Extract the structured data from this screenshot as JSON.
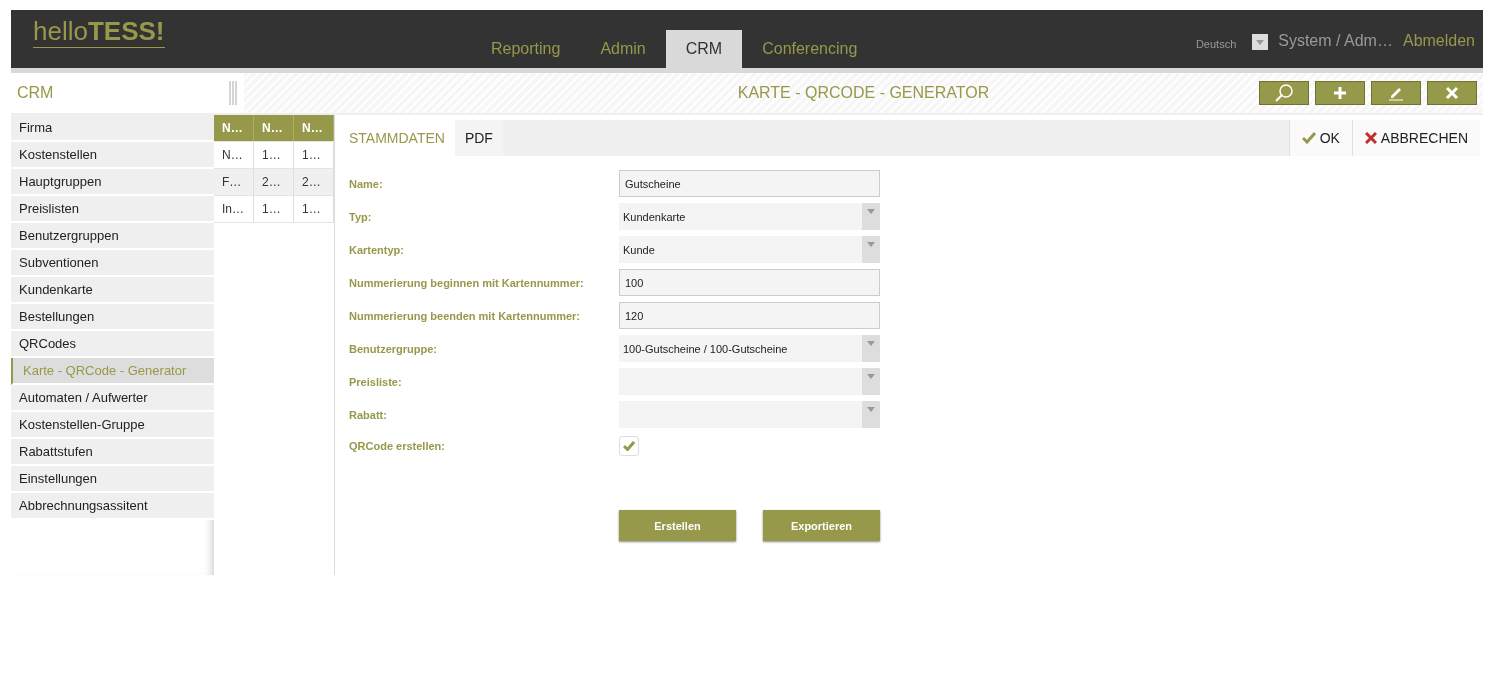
{
  "logo": {
    "light": "hello",
    "bold": "TESS!"
  },
  "nav": [
    {
      "label": "Reporting",
      "selected": false
    },
    {
      "label": "Admin",
      "selected": false
    },
    {
      "label": "CRM",
      "selected": true
    },
    {
      "label": "Conferencing",
      "selected": false
    }
  ],
  "language": "Deutsch",
  "user": "System / Adm…",
  "logout": "Abmelden",
  "module_title": "CRM",
  "page_title": "KARTE - QRCODE - GENERATOR",
  "sidebar": {
    "items": [
      {
        "label": "Firma",
        "selected": false
      },
      {
        "label": "Kostenstellen",
        "selected": false
      },
      {
        "label": "Hauptgruppen",
        "selected": false
      },
      {
        "label": "Preislisten",
        "selected": false
      },
      {
        "label": "Benutzergruppen",
        "selected": false
      },
      {
        "label": "Subventionen",
        "selected": false
      },
      {
        "label": "Kundenkarte",
        "selected": false
      },
      {
        "label": "Bestellungen",
        "selected": false
      },
      {
        "label": "QRCodes",
        "selected": false
      },
      {
        "label": "Karte - QRCode - Generator",
        "selected": true
      },
      {
        "label": "Automaten / Aufwerter",
        "selected": false
      },
      {
        "label": "Kostenstellen-Gruppe",
        "selected": false
      },
      {
        "label": "Rabattstufen",
        "selected": false
      },
      {
        "label": "Einstellungen",
        "selected": false
      },
      {
        "label": "Abbrechnungsassitent",
        "selected": false
      }
    ]
  },
  "table": {
    "columns": [
      "N…",
      "N…",
      "N…"
    ],
    "rows": [
      [
        "N…",
        "1…",
        "1…"
      ],
      [
        "F…",
        "2…",
        "2…"
      ],
      [
        "In…",
        "1…",
        "1…"
      ]
    ]
  },
  "tabs": [
    {
      "label": "STAMMDATEN",
      "selected": true
    },
    {
      "label": "PDF",
      "selected": false
    }
  ],
  "actions": {
    "ok": "OK",
    "cancel": "ABBRECHEN"
  },
  "form": [
    {
      "kind": "text",
      "label": "Name:",
      "value": "Gutscheine"
    },
    {
      "kind": "select",
      "label": "Typ:",
      "value": "Kundenkarte"
    },
    {
      "kind": "select",
      "label": "Kartentyp:",
      "value": "Kunde"
    },
    {
      "kind": "text",
      "label": "Nummerierung beginnen mit Kartennummer:",
      "value": "100"
    },
    {
      "kind": "text",
      "label": "Nummerierung beenden mit Kartennummer:",
      "value": "120"
    },
    {
      "kind": "select",
      "label": "Benutzergruppe:",
      "value": "100-Gutscheine / 100-Gutscheine"
    },
    {
      "kind": "select",
      "label": "Preisliste:"
    },
    {
      "kind": "select",
      "label": "Rabatt:"
    },
    {
      "kind": "checkbox",
      "label": "QRCode erstellen:",
      "checked": true
    }
  ],
  "buttons": [
    "Erstellen",
    "Exportieren"
  ]
}
